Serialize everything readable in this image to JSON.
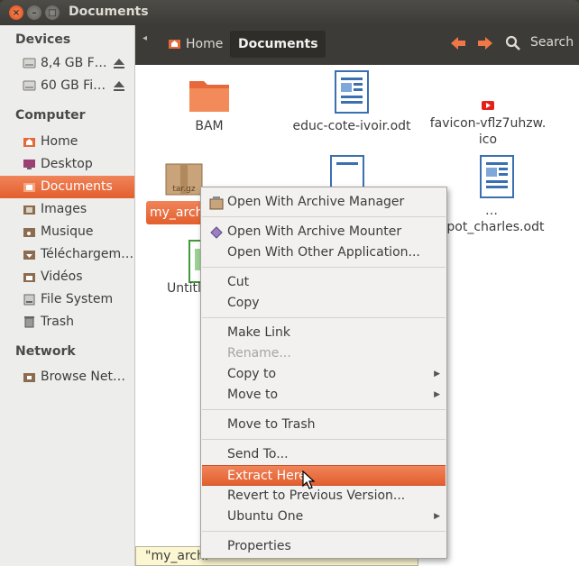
{
  "window": {
    "title": "Documents"
  },
  "sidebar": {
    "devices_heading": "Devices",
    "devices": [
      {
        "label": "8,4 GB F…"
      },
      {
        "label": "60 GB Fi…"
      }
    ],
    "computer_heading": "Computer",
    "computer": [
      {
        "label": "Home",
        "icon": "home-folder-icon"
      },
      {
        "label": "Desktop",
        "icon": "desktop-icon"
      },
      {
        "label": "Documents",
        "icon": "documents-folder-icon",
        "active": true
      },
      {
        "label": "Images",
        "icon": "images-folder-icon"
      },
      {
        "label": "Musique",
        "icon": "music-folder-icon"
      },
      {
        "label": "Téléchargem…",
        "icon": "downloads-folder-icon"
      },
      {
        "label": "Vidéos",
        "icon": "videos-folder-icon"
      },
      {
        "label": "File System",
        "icon": "filesystem-icon"
      },
      {
        "label": "Trash",
        "icon": "trash-icon"
      }
    ],
    "network_heading": "Network",
    "network": [
      {
        "label": "Browse Net…",
        "icon": "network-icon"
      }
    ]
  },
  "toolbar": {
    "breadcrumb_home": "Home",
    "breadcrumb_current": "Documents",
    "search_label": "Search"
  },
  "files": [
    {
      "name": "BAM",
      "type": "folder"
    },
    {
      "name": "educ-cote-ivoir.odt",
      "type": "odt"
    },
    {
      "name_line1": "favicon-vflz7uhzw.",
      "name_line2": "ico",
      "type": "ico"
    },
    {
      "name": "my_archi",
      "type": "archive",
      "selected": true,
      "icon_label": "tar.gz"
    },
    {
      "name": "…ppot_charles.odt",
      "type": "odt"
    },
    {
      "name": "Untitle",
      "type": "spreadsheet"
    }
  ],
  "context_menu": {
    "items": [
      {
        "label": "Open With Archive Manager",
        "icon": "archive-manager-icon"
      },
      {
        "label": "Open With Archive Mounter",
        "icon": "archive-mounter-icon"
      },
      {
        "label": "Open With Other Application..."
      },
      {
        "label": "Cut"
      },
      {
        "label": "Copy"
      },
      {
        "label": "Make Link"
      },
      {
        "label": "Rename...",
        "disabled": true
      },
      {
        "label": "Copy to",
        "submenu": true
      },
      {
        "label": "Move to",
        "submenu": true
      },
      {
        "label": "Move to Trash"
      },
      {
        "label": "Send To..."
      },
      {
        "label": "Extract Here",
        "highlighted": true
      },
      {
        "label": "Revert to Previous Version..."
      },
      {
        "label": "Ubuntu One",
        "submenu": true
      },
      {
        "label": "Properties"
      }
    ]
  },
  "statusbar": {
    "text": "\"my_archi"
  },
  "colors": {
    "accent": "#e35f2e",
    "titlebar": "#3c3b37",
    "sidebar": "#ededeb"
  }
}
